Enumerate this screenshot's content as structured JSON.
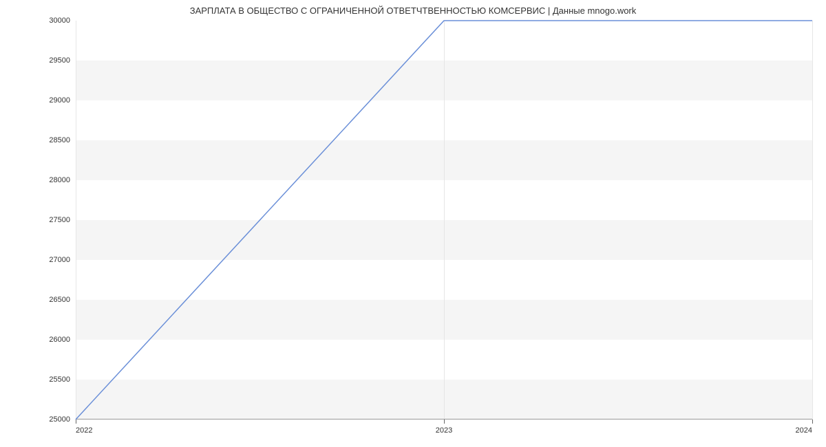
{
  "chart_data": {
    "type": "line",
    "title": "ЗАРПЛАТА В ОБЩЕСТВО С ОГРАНИЧЕННОЙ ОТВЕТЧТВЕННОСТЬЮ КОМСЕРВИС | Данные mnogo.work",
    "x": [
      2022,
      2023,
      2024
    ],
    "values": [
      25000,
      30000,
      30000
    ],
    "xlabel": "",
    "ylabel": "",
    "xlim": [
      2022,
      2024
    ],
    "ylim": [
      25000,
      30000
    ],
    "x_ticks": [
      2022,
      2023,
      2024
    ],
    "y_ticks": [
      25000,
      25500,
      26000,
      26500,
      27000,
      27500,
      28000,
      28500,
      29000,
      29500,
      30000
    ],
    "x_tick_labels": [
      "2022",
      "2023",
      "2024"
    ],
    "y_tick_labels": [
      "25000",
      "25500",
      "26000",
      "26500",
      "27000",
      "27500",
      "28000",
      "28500",
      "29000",
      "29500",
      "30000"
    ],
    "line_color": "#6a8fd8"
  }
}
